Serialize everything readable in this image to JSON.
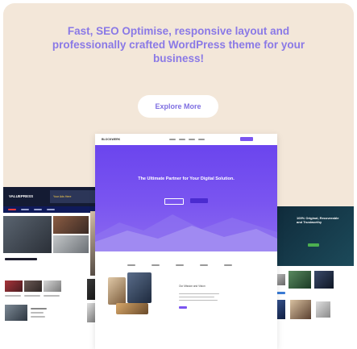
{
  "promo": {
    "headline": "Fast, SEO Optimise, responsive layout and professionally crafted WordPress theme for your business!",
    "cta_label": "Explore More"
  },
  "main_theme": {
    "logo": "BLOCKWERK",
    "hero_title": "The Ultimate Partner for Your Digital Solution.",
    "about_heading": "Our Mission and Vision"
  },
  "left_theme": {
    "logo": "VALUEPRESS",
    "promo_text": "Your Ads Here"
  },
  "right_theme": {
    "banner_text": "100% Original, Recoverable and Trustworthy"
  },
  "colors": {
    "background": "#f3e7d9",
    "accent": "#7b55f0",
    "headline": "#8a79e6"
  }
}
